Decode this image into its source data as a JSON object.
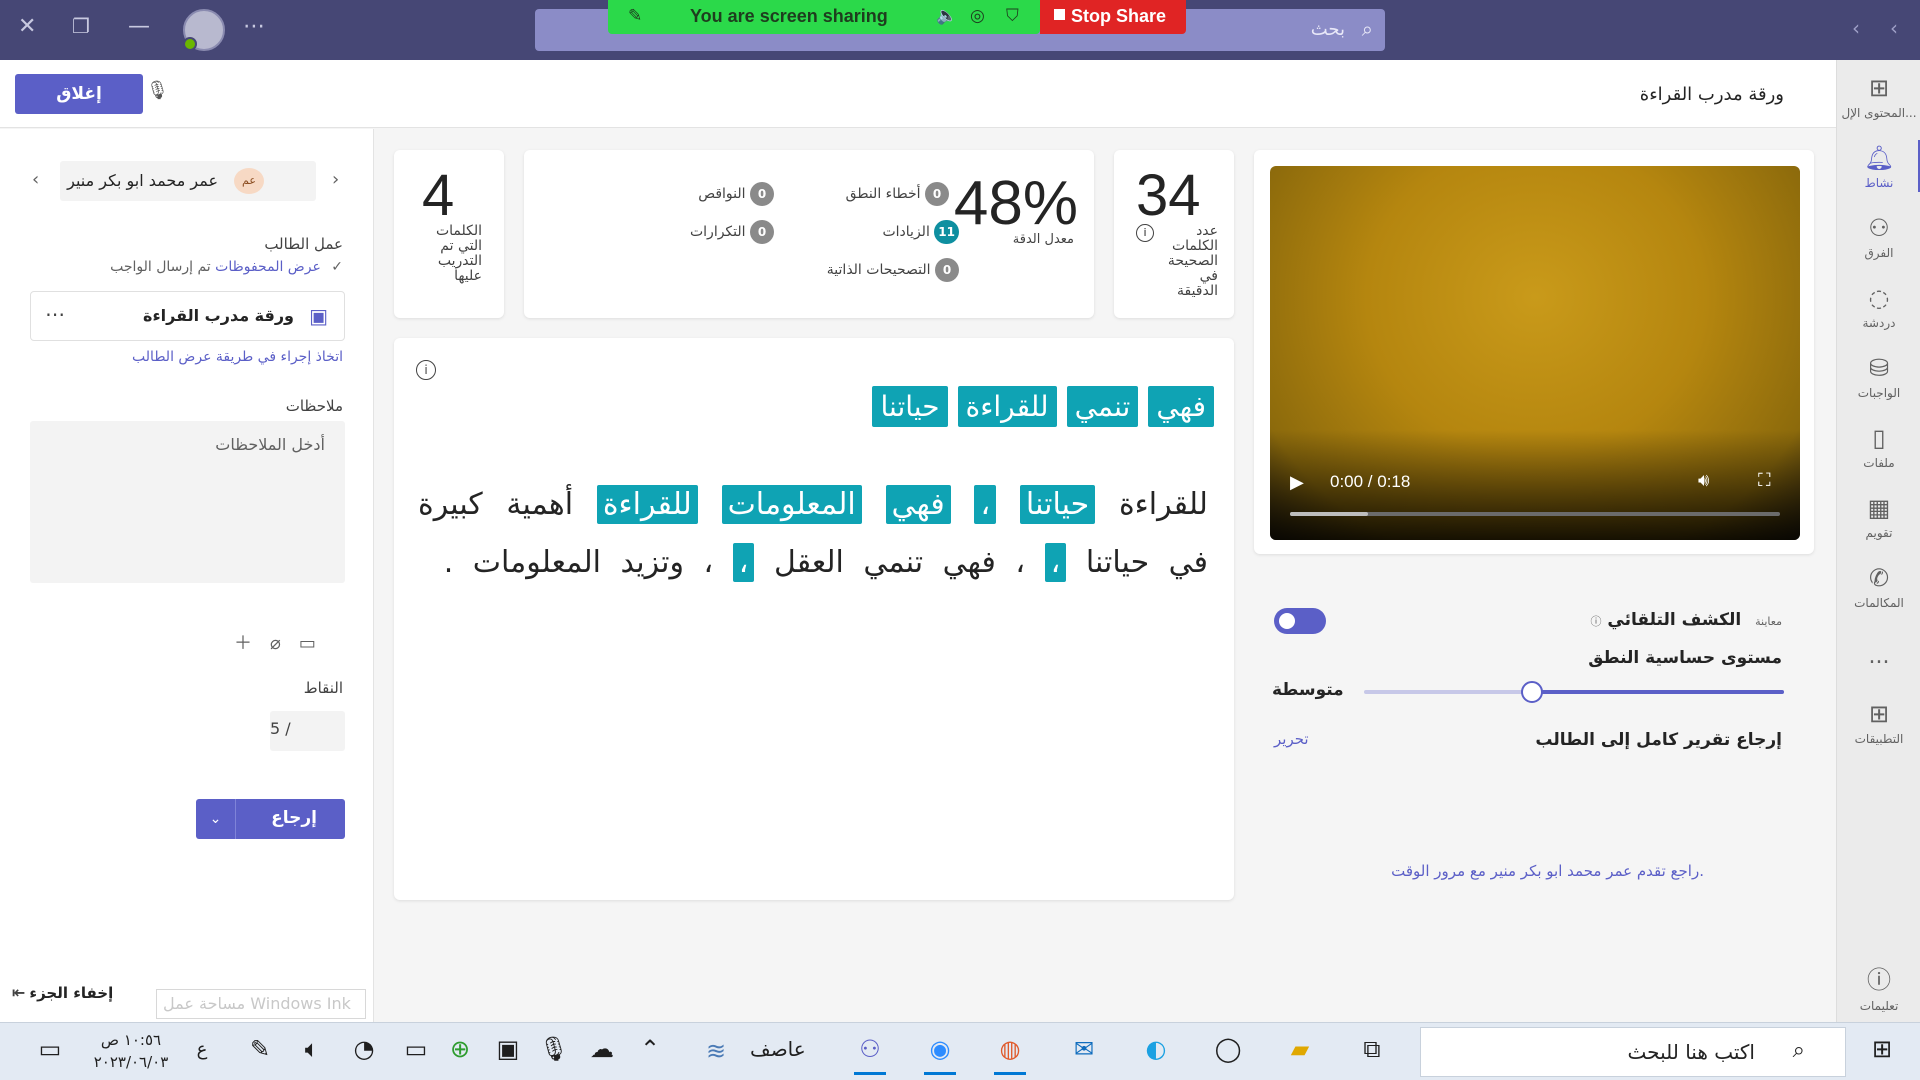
{
  "titlebar": {
    "search_placeholder": "بحث",
    "share_status": "You are screen sharing",
    "stop_share": "Stop Share"
  },
  "rail": {
    "items": [
      {
        "label": "المحتوى الإل...",
        "icon": "content-icon"
      },
      {
        "label": "نشاط",
        "icon": "bell-icon",
        "active": true
      },
      {
        "label": "الفرق",
        "icon": "teams-icon"
      },
      {
        "label": "دردشة",
        "icon": "chat-icon"
      },
      {
        "label": "الواجبات",
        "icon": "assignments-icon"
      },
      {
        "label": "ملفات",
        "icon": "file-icon"
      },
      {
        "label": "تقويم",
        "icon": "calendar-icon"
      },
      {
        "label": "المكالمات",
        "icon": "phone-icon"
      },
      {
        "label": "...",
        "icon": "more-icon"
      },
      {
        "label": "التطبيقات",
        "icon": "apps-icon"
      },
      {
        "label": "تعليمات",
        "icon": "help-icon"
      }
    ]
  },
  "header": {
    "title": "ورقة مدرب القراءة",
    "close_label": "إغلاق"
  },
  "left_panel": {
    "student_name": "عمر محمد ابو بكر منير",
    "student_initials": "عم",
    "student_work_label": "عمل الطالب",
    "submitted_text": "تم إرسال الواجب",
    "view_saved_link": "عرض المحفوظات",
    "work_title": "ورقة مدرب القراءة",
    "action_link": "اتخاذ إجراء في طريقة عرض الطالب",
    "notes_label": "ملاحظات",
    "notes_placeholder": "أدخل الملاحظات",
    "points_label": "النقاط",
    "points_value": "5 /",
    "return_label": "إرجاع",
    "hide_pane": "إخفاء الجزء",
    "ink_watermark": "مساحة عمل Windows Ink"
  },
  "stats": {
    "words_practiced": "4",
    "words_practiced_label": "الكلمات التي تم التدريب عليها",
    "accuracy": "48%",
    "accuracy_label": "معدل الدقة",
    "mispronunciations_label": "أخطاء النطق",
    "mispronunciations": "0",
    "omissions_label": "النواقص",
    "omissions": "0",
    "insertions_label": "الزيادات",
    "insertions": "11",
    "repetitions_label": "التكرارات",
    "repetitions": "0",
    "self_corrections_label": "التصحيحات الذاتية",
    "self_corrections": "0",
    "wcpm": "34",
    "wcpm_label": "عدد الكلمات الصحيحة في الدقيقة"
  },
  "reading": {
    "practice_words": [
      "فهي",
      "تنمي",
      "للقراءة",
      "حياتنا"
    ],
    "para_plain_1": "للقراءة",
    "para_hl_1": "حياتنا",
    "para_hl_2": "،",
    "para_hl_3": "فهي",
    "para_hl_4": "المعلومات",
    "para_hl_5": "للقراءة",
    "para_plain_2": "أهمية كبيرة في حياتنا",
    "para_hl_6": "،",
    "para_plain_3": "، فهي تنمي العقل",
    "para_hl_7": "،",
    "para_plain_4": "، وتزيد المعلومات ."
  },
  "video": {
    "time": "0:00 / 0:18",
    "buffered_fraction": 0.16
  },
  "settings": {
    "auto_detect_label": "الكشف التلقائي",
    "preview_tag": "معاينة",
    "sensitivity_label": "مستوى حساسية النطق",
    "sensitivity_value": "متوسطة",
    "sensitivity_fraction": 0.6,
    "return_full_report": "إرجاع تقرير كامل إلى الطالب",
    "edit_link": "تحرير",
    "progress_note": "راجع تقدم عمر محمد ابو بكر منير مع مرور الوقت."
  },
  "taskbar": {
    "search_placeholder": "اكتب هنا للبحث",
    "weather": "عاصف",
    "time": "١٠:٥٦ ص",
    "date": "٢٠٢٣/٠٦/٠٣",
    "lang": "ع"
  },
  "colors": {
    "accent": "#5b5fc7",
    "titlebar": "#464775",
    "highlight": "#0fa3b4",
    "share_green": "#2bd94a",
    "stop_red": "#e02424"
  }
}
